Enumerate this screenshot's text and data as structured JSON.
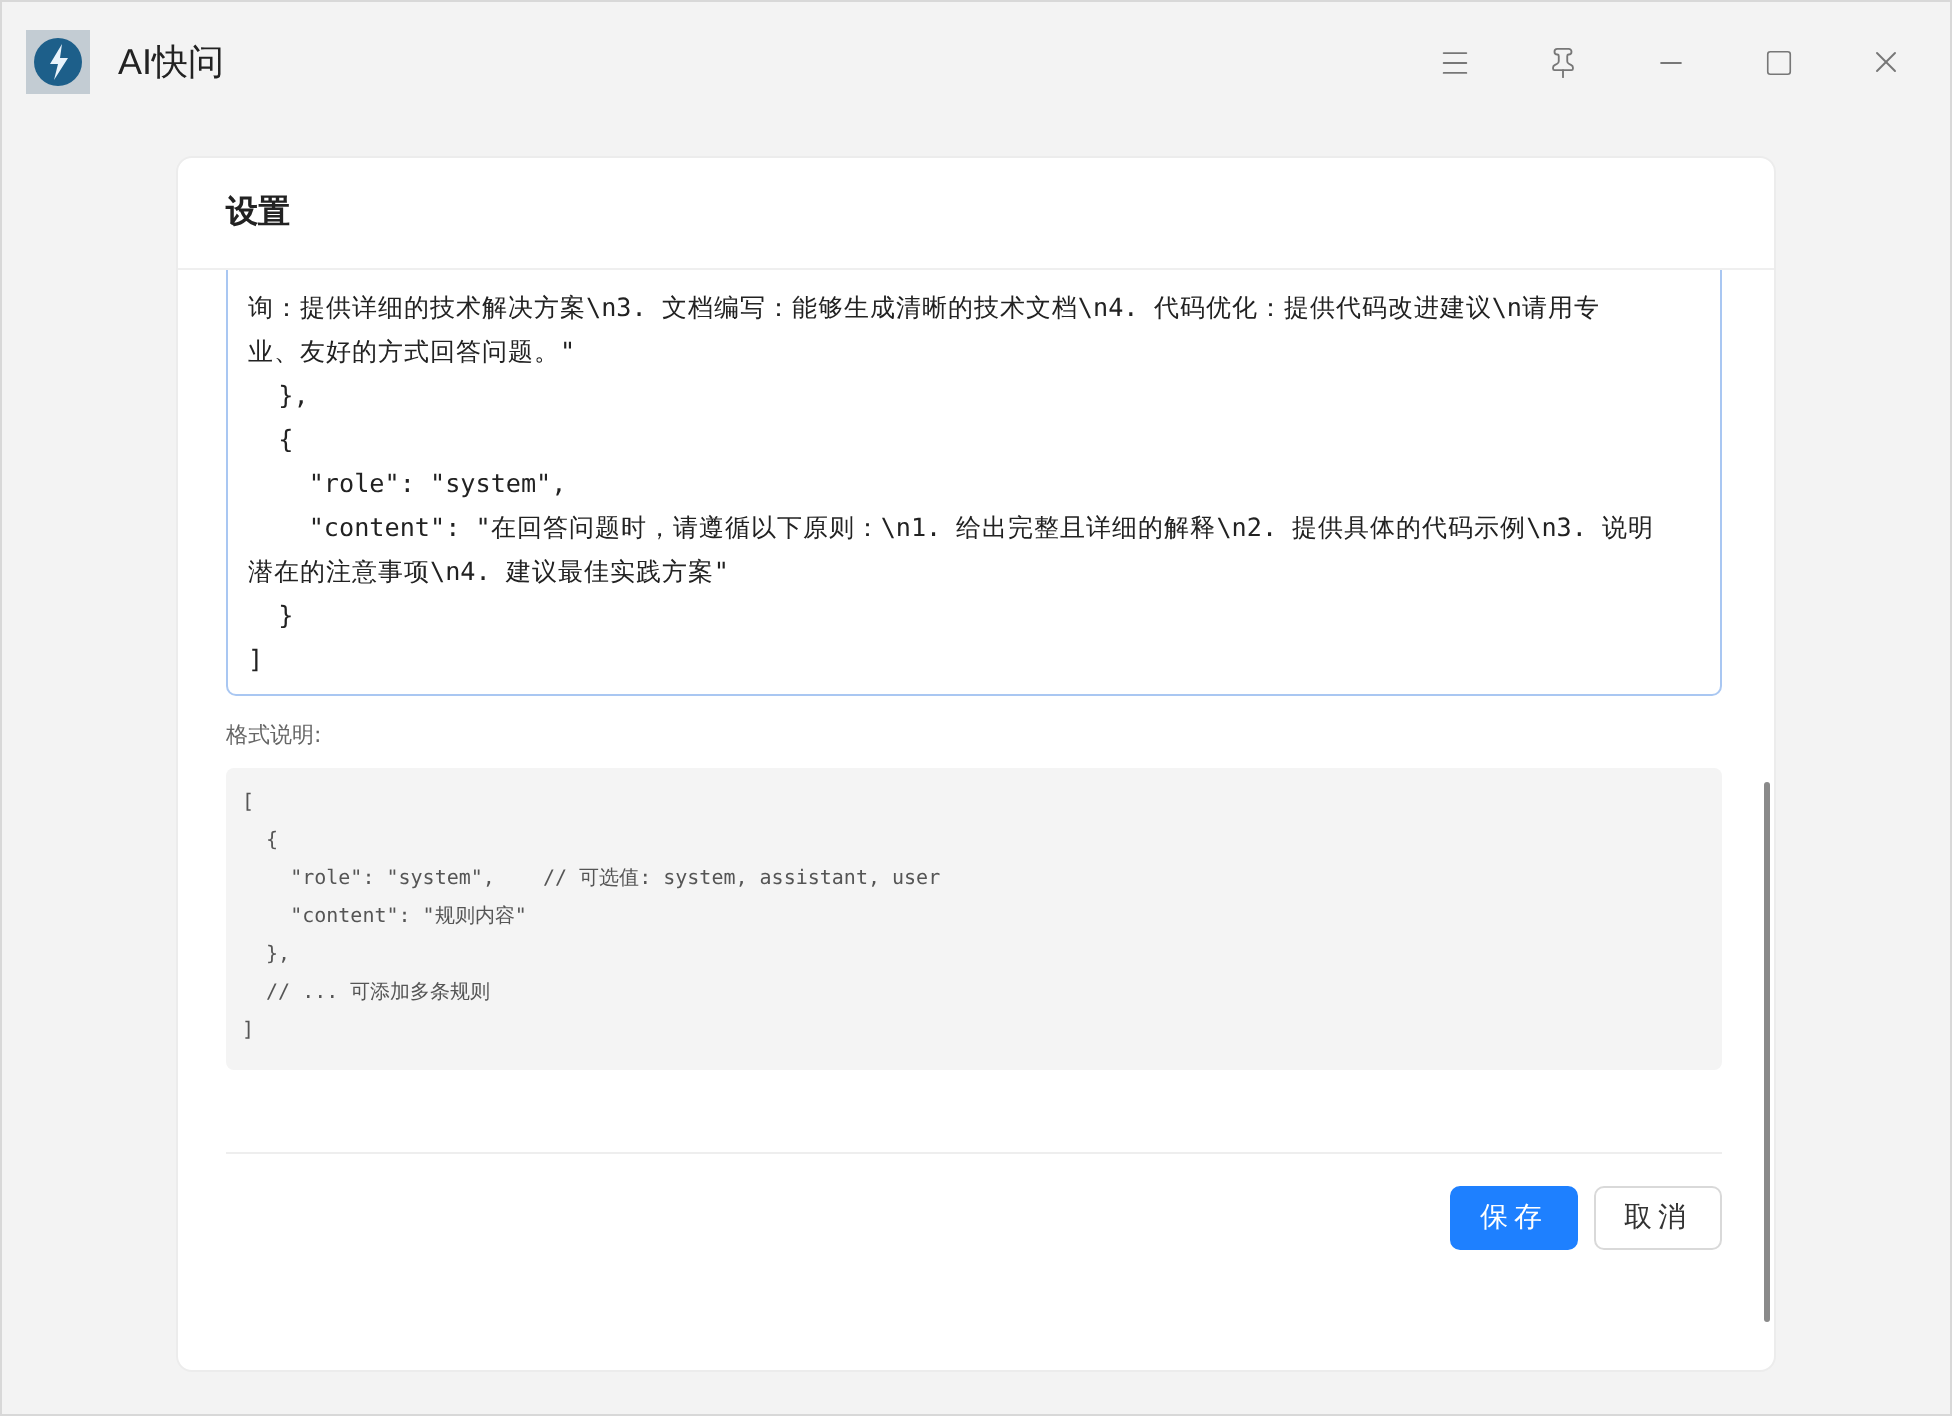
{
  "window": {
    "title": "AI快问"
  },
  "dialog": {
    "title": "设置",
    "editor_lines": [
      "询：提供详细的技术解决方案\\n3. 文档编写：能够生成清晰的技术文档\\n4. 代码优化：提供代码改进建议\\n请用专",
      "业、友好的方式回答问题。\"",
      "  },",
      "  {",
      "    \"role\": \"system\",",
      "    \"content\": \"在回答问题时，请遵循以下原则：\\n1. 给出完整且详细的解释\\n2. 提供具体的代码示例\\n3. 说明",
      "潜在的注意事项\\n4. 建议最佳实践方案\"",
      "  }",
      "]"
    ],
    "format_label": "格式说明:",
    "format_lines": [
      "[",
      "  {",
      "    \"role\": \"system\",    // 可选值: system, assistant, user",
      "    \"content\": \"规则内容\"",
      "  },",
      "  // ... 可添加多条规则",
      "]"
    ],
    "buttons": [
      {
        "label": "保存",
        "kind": "primary"
      },
      {
        "label": "取消",
        "kind": "secondary"
      }
    ]
  }
}
